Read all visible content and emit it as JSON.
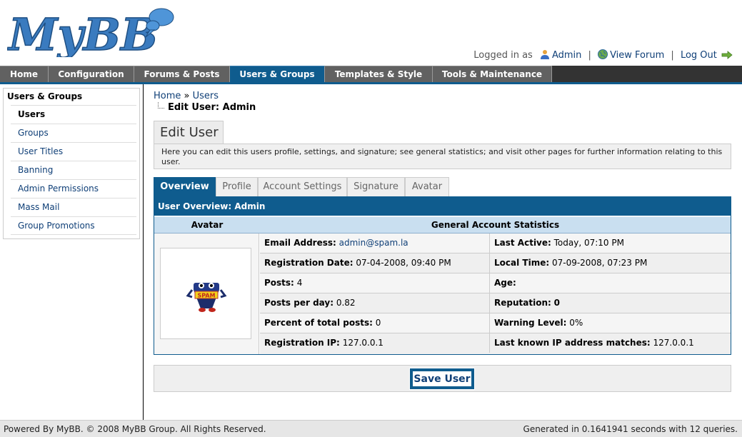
{
  "header": {
    "logo_text": "MyBB",
    "logged_in_as": "Logged in as",
    "username": "Admin",
    "view_forum": "View Forum",
    "log_out": "Log Out"
  },
  "menu": {
    "tabs": [
      {
        "label": "Home",
        "active": false
      },
      {
        "label": "Configuration",
        "active": false
      },
      {
        "label": "Forums & Posts",
        "active": false
      },
      {
        "label": "Users & Groups",
        "active": true
      },
      {
        "label": "Templates & Style",
        "active": false
      },
      {
        "label": "Tools & Maintenance",
        "active": false
      }
    ]
  },
  "sidebar": {
    "title": "Users & Groups",
    "items": [
      {
        "label": "Users",
        "active": true
      },
      {
        "label": "Groups",
        "active": false
      },
      {
        "label": "User Titles",
        "active": false
      },
      {
        "label": "Banning",
        "active": false
      },
      {
        "label": "Admin Permissions",
        "active": false
      },
      {
        "label": "Mass Mail",
        "active": false
      },
      {
        "label": "Group Promotions",
        "active": false
      }
    ]
  },
  "breadcrumb": {
    "home": "Home",
    "sep": "»",
    "users": "Users",
    "current": "Edit User: Admin"
  },
  "page": {
    "heading": "Edit User",
    "description": "Here you can edit this users profile, settings, and signature; see general statistics; and visit other pages for further information relating to this user."
  },
  "user_tabs": [
    {
      "label": "Overview",
      "active": true
    },
    {
      "label": "Profile",
      "active": false
    },
    {
      "label": "Account Settings",
      "active": false
    },
    {
      "label": "Signature",
      "active": false
    },
    {
      "label": "Avatar",
      "active": false
    }
  ],
  "overview": {
    "title": "User Overview: Admin",
    "avatar_header": "Avatar",
    "stats_header": "General Account Statistics",
    "avatar_badge_text": "SPAM",
    "rows": [
      {
        "l_label": "Email Address:",
        "l_value": "admin@spam.la",
        "r_label": "Last Active:",
        "r_value": "Today, 07:10 PM"
      },
      {
        "l_label": "Registration Date:",
        "l_value": "07-04-2008, 09:40 PM",
        "r_label": "Local Time:",
        "r_value": "07-09-2008, 07:23 PM"
      },
      {
        "l_label": "Posts:",
        "l_value": "4",
        "r_label": "Age:",
        "r_value": ""
      },
      {
        "l_label": "Posts per day:",
        "l_value": "0.82",
        "r_label": "Reputation:",
        "r_value": "0"
      },
      {
        "l_label": "Percent of total posts:",
        "l_value": "0",
        "r_label": "Warning Level:",
        "r_value": "0%"
      },
      {
        "l_label": "Registration IP:",
        "l_value": "127.0.0.1",
        "r_label": "Last known IP address matches:",
        "r_value": "127.0.0.1"
      }
    ]
  },
  "actions": {
    "save": "Save User"
  },
  "footer": {
    "left": "Powered By MyBB. © 2008 MyBB Group. All Rights Reserved.",
    "right": "Generated in 0.1641941 seconds with 12 queries."
  },
  "colors": {
    "accent": "#0f5c8e",
    "menu_bg": "#616161",
    "link": "#0f3f77"
  }
}
